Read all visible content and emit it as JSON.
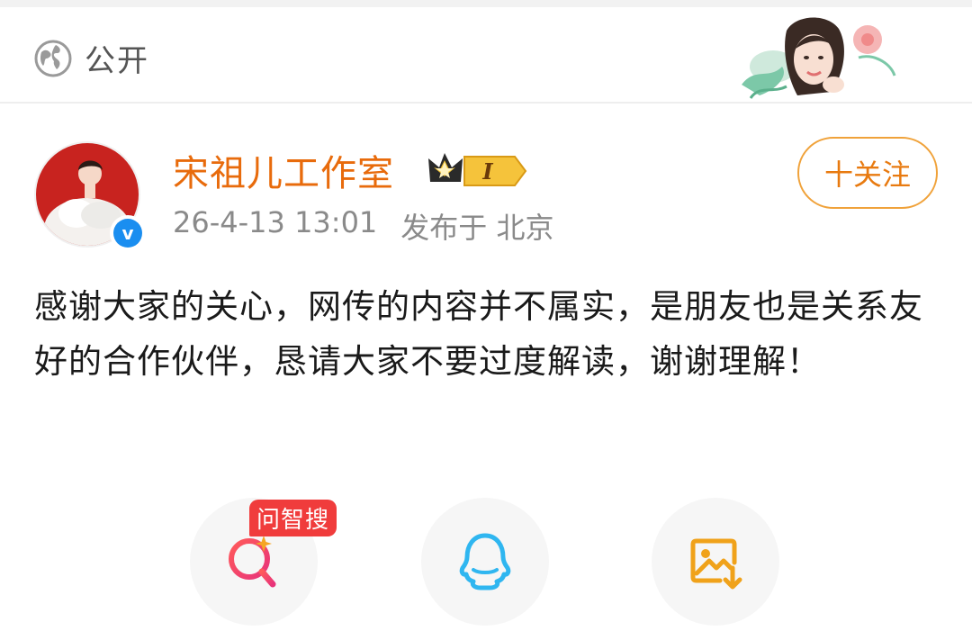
{
  "header": {
    "visibility_label": "公开",
    "visibility_icon": "globe-icon"
  },
  "post": {
    "author": "宋祖儿工作室",
    "member_badge": "I",
    "timestamp": "26-4-13 13:01",
    "published_from": "发布于 北京",
    "follow_label": "十关注",
    "content": "感谢大家的关心，网传的内容并不属实，是朋友也是关系友好的合作伙伴，恳请大家不要过度解读，谢谢理解！"
  },
  "actions": {
    "search_tag": "问智搜",
    "items": [
      "search-ai-icon",
      "qq-icon",
      "save-image-icon"
    ]
  },
  "colors": {
    "accent": "#e86b0c",
    "follow_border": "#f0a23a",
    "verified": "#1a8ef0",
    "tag": "#f03c3c"
  }
}
